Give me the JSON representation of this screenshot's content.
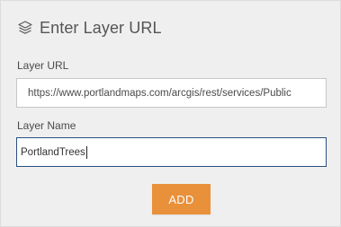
{
  "header": {
    "icon": "layers-icon",
    "title": "Enter Layer URL"
  },
  "form": {
    "url_label": "Layer URL",
    "url_value": "https://www.portlandmaps.com/arcgis/rest/services/Public",
    "name_label": "Layer Name",
    "name_value": "PortlandTrees"
  },
  "actions": {
    "add_label": "ADD"
  },
  "colors": {
    "panel_bg": "#efefef",
    "accent_button": "#e9903a",
    "focus_border": "#2a4f82",
    "text": "#555555"
  }
}
